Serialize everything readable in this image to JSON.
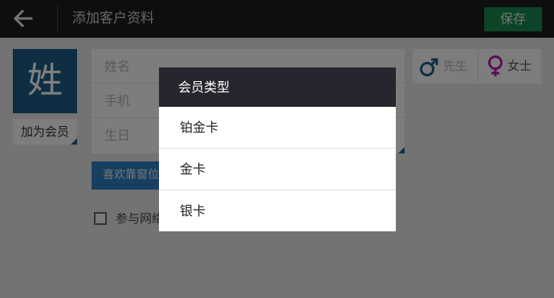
{
  "header": {
    "back_icon": "arrow-left-icon",
    "title": "添加客户资料",
    "save_label": "保存"
  },
  "form": {
    "avatar_text": "姓",
    "member_button": "加为会员",
    "fields": {
      "name_placeholder": "姓名",
      "phone_placeholder": "手机",
      "birthday_placeholder": "生日"
    },
    "gender": {
      "male_label": "先生",
      "female_label": "女士",
      "male_icon": "male-icon",
      "female_icon": "female-icon"
    },
    "preference_button": "喜欢靠窗位",
    "activity_checkbox_label": "参与网络",
    "colors": {
      "topbar": "#1d1d1f",
      "save": "#178a4d",
      "avatar": "#1c5f86",
      "male": "#1c5f86",
      "female": "#b21fa7",
      "preference": "#2f7ec0"
    }
  },
  "dialog": {
    "title": "会员类型",
    "options": [
      "铂金卡",
      "金卡",
      "银卡"
    ]
  }
}
